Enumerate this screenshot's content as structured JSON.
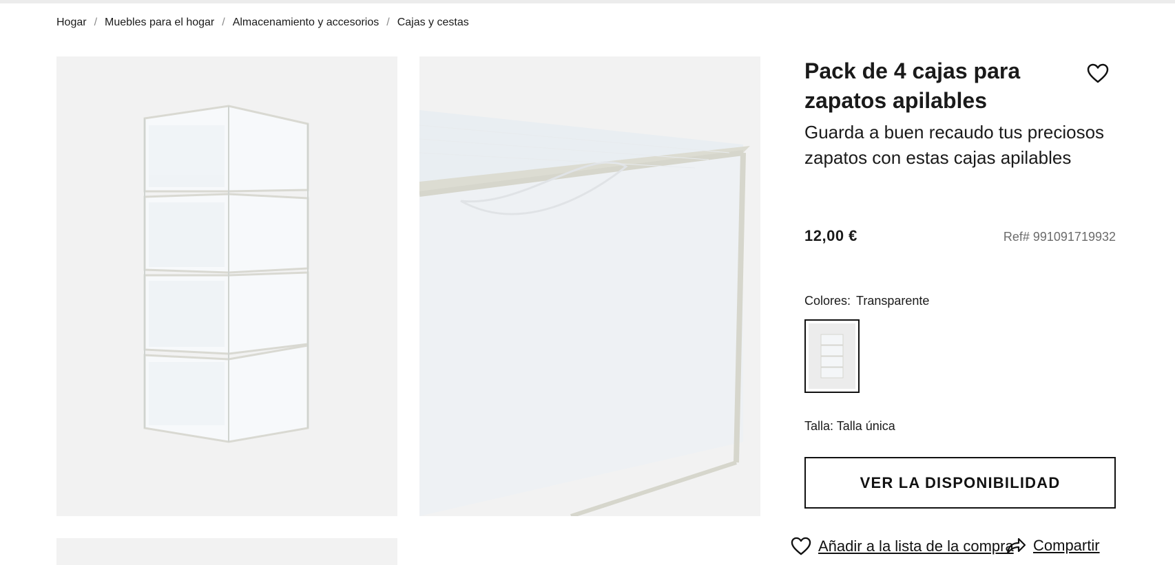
{
  "breadcrumb": [
    {
      "label": "Hogar"
    },
    {
      "label": "Muebles para el hogar"
    },
    {
      "label": "Almacenamiento y accesorios"
    },
    {
      "label": "Cajas y cestas"
    }
  ],
  "product": {
    "title": "Pack de 4 cajas para zapatos apilables",
    "description": "Guarda a buen recaudo tus preciosos zapatos con estas cajas apilables",
    "price": "12,00 €",
    "reference": "Ref# 991091719932",
    "colors_label": "Colores:",
    "color_value": "Transparente",
    "size_text": "Talla: Talla única",
    "availability_button": "VER LA DISPONIBILIDAD",
    "add_to_list": "Añadir a la lista de la compra",
    "share": "Compartir"
  },
  "icons": {
    "wishlist": "heart-icon",
    "share": "share-arrow-icon"
  },
  "colors": {
    "text": "#1a1a1a",
    "muted": "#6b6b6b",
    "image_bg": "#f2f2f2",
    "border": "#111111"
  }
}
